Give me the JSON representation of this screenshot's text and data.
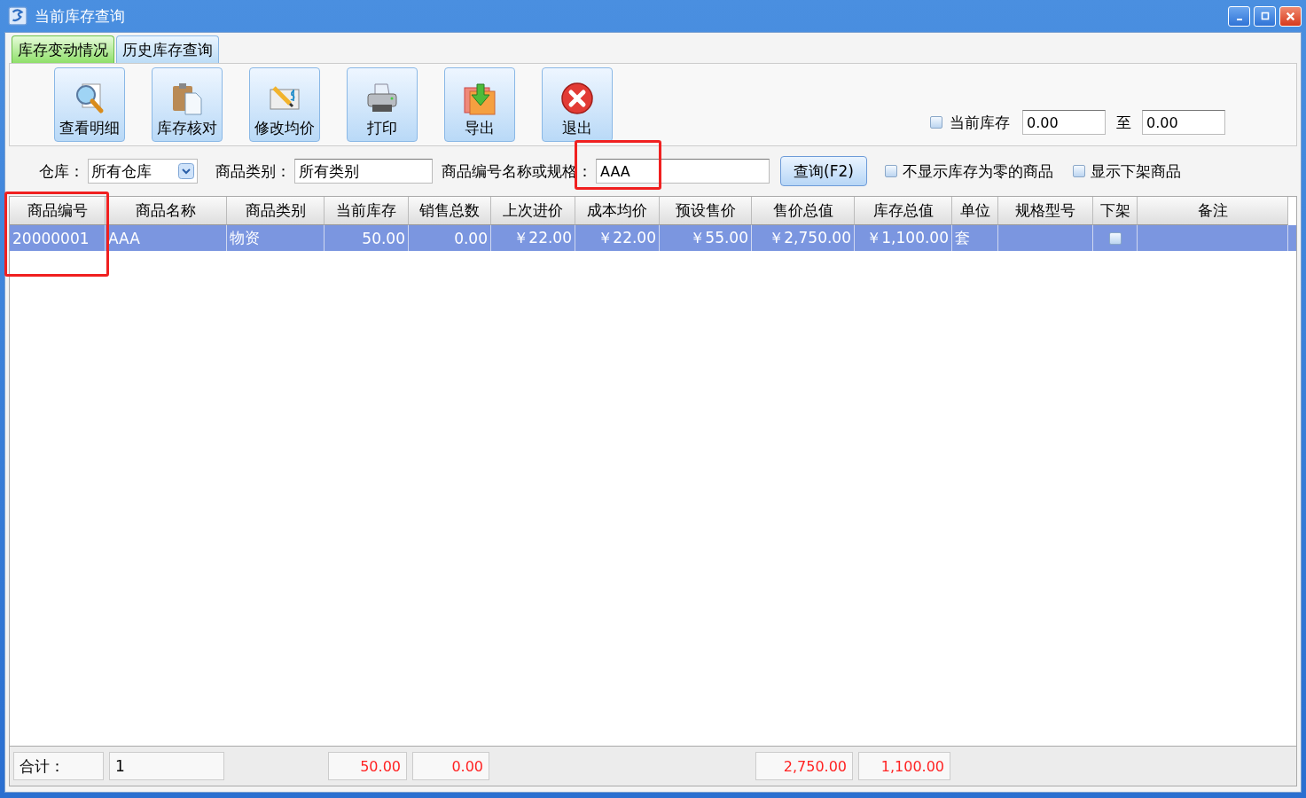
{
  "window": {
    "title": "当前库存查询"
  },
  "tabs": [
    {
      "label": "库存变动情况",
      "selected": true
    },
    {
      "label": "历史库存查询",
      "selected": false
    }
  ],
  "toolbar": [
    {
      "label": "查看明细",
      "kind": "magnifier"
    },
    {
      "label": "库存核对",
      "kind": "clipboard"
    },
    {
      "label": "修改均价",
      "kind": "pencil"
    },
    {
      "label": "打印",
      "kind": "printer"
    },
    {
      "label": "导出",
      "kind": "export"
    },
    {
      "label": "退出",
      "kind": "exit"
    }
  ],
  "stock_range": {
    "label": "当前库存",
    "checked": false,
    "from": "0.00",
    "separator": "至",
    "to": "0.00"
  },
  "filters": {
    "warehouse_label": "仓库：",
    "warehouse": "所有仓库",
    "category_label": "商品类别：",
    "category": "所有类别",
    "search_label": "商品编号名称或规格：",
    "search": "AAA",
    "search_highlighted": true,
    "query_button": "查询(F2)"
  },
  "options": [
    {
      "label": "不显示库存为零的商品",
      "checked": false
    },
    {
      "label": "显示下架商品",
      "checked": false
    }
  ],
  "table": {
    "columns": [
      {
        "title": "商品编号",
        "kind": "text",
        "highlighted": true,
        "total": "合计："
      },
      {
        "title": "商品名称",
        "kind": "text",
        "highlighted": false,
        "total": "1"
      },
      {
        "title": "商品类别",
        "kind": "text",
        "highlighted": false
      },
      {
        "title": "当前库存",
        "kind": "number",
        "highlighted": false,
        "total": "50.00"
      },
      {
        "title": "销售总数",
        "kind": "number",
        "highlighted": false,
        "total": "0.00"
      },
      {
        "title": "上次进价",
        "kind": "number",
        "highlighted": false
      },
      {
        "title": "成本均价",
        "kind": "number",
        "highlighted": false
      },
      {
        "title": "预设售价",
        "kind": "number",
        "highlighted": false
      },
      {
        "title": "售价总值",
        "kind": "number",
        "highlighted": false,
        "total": "2,750.00"
      },
      {
        "title": "库存总值",
        "kind": "number",
        "highlighted": false,
        "total": "1,100.00"
      },
      {
        "title": "单位",
        "kind": "text",
        "highlighted": false
      },
      {
        "title": "规格型号",
        "kind": "text",
        "highlighted": false
      },
      {
        "title": "下架",
        "kind": "flag",
        "highlighted": false
      },
      {
        "title": "备注",
        "kind": "text",
        "highlighted": false
      }
    ],
    "rows": [
      {
        "selected": true,
        "cells": [
          "20000001",
          "AAA",
          "物资",
          "50.00",
          "0.00",
          "￥22.00",
          "￥22.00",
          "￥55.00",
          "￥2,750.00",
          "￥1,100.00",
          "套",
          "",
          false,
          ""
        ]
      }
    ]
  }
}
